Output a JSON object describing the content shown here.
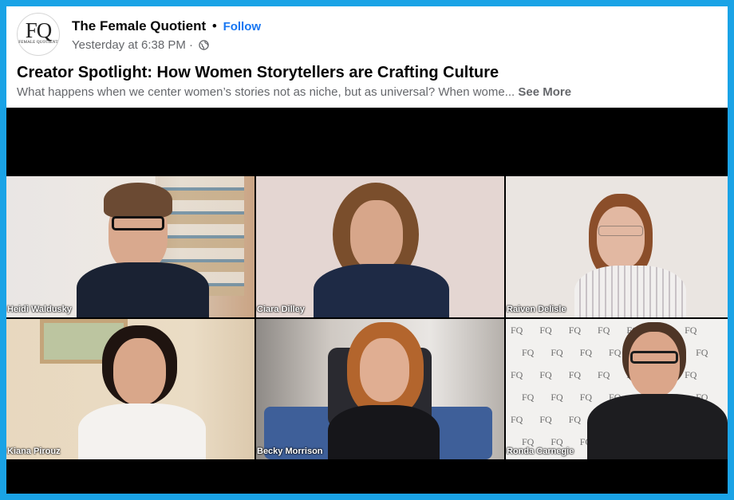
{
  "post": {
    "avatar_text": "FQ",
    "avatar_subtext": "FEMALE QUOTIENT",
    "page_name": "The Female Quotient",
    "separator": "•",
    "follow_label": "Follow",
    "timestamp": "Yesterday at 6:38 PM",
    "meta_separator": "·",
    "privacy_icon": "globe-icon",
    "title": "Creator Spotlight: How Women Storytellers are Crafting Culture",
    "description": "What happens when we center women’s stories not as niche, but as universal? When wome...",
    "see_more_label": "See More"
  },
  "video": {
    "participants": [
      {
        "name": "Heidi Waldusky"
      },
      {
        "name": "Ciara Dilley"
      },
      {
        "name": "Raiven Delisle"
      },
      {
        "name": "Kiana Pirouz"
      },
      {
        "name": "Becky Morrison"
      },
      {
        "name": "Ronda Carnegie"
      }
    ],
    "backdrop_logo": "FQ"
  },
  "colors": {
    "border": "#1aa3e6",
    "link": "#1877f2",
    "secondary_text": "#65676b",
    "primary_text": "#050505"
  }
}
